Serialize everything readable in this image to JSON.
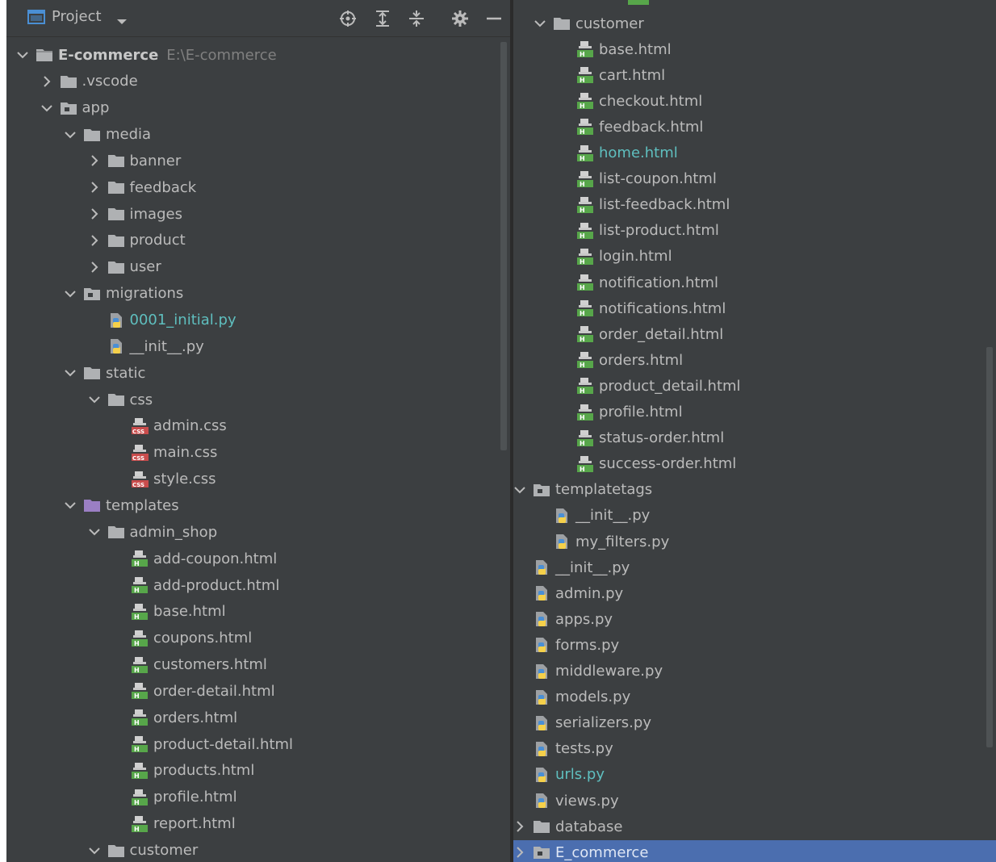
{
  "toolbar": {
    "title": "Project",
    "icons": [
      "project-window-icon",
      "dropdown-arrow-icon",
      "locate-icon",
      "expand-all-icon",
      "collapse-all-icon",
      "gear-icon",
      "hide-icon"
    ]
  },
  "colors": {
    "panel_bg": "#3c3f41",
    "text": "#bbbbbb",
    "modified_text": "#5fbfbf",
    "selection": "#4b6eaf",
    "folder": "#afb1b3",
    "templates_folder": "#9b7fc4",
    "python_blue": "#4a8fd4",
    "python_yellow": "#f5d04a",
    "html_green": "#57a64a",
    "css_red": "#c94c4c"
  },
  "left_tree": [
    {
      "depth": 0,
      "arrow": "down",
      "icon": "module-folder-icon",
      "label": "E-commerce",
      "path": "E:\\E-commerce",
      "style": "bold"
    },
    {
      "depth": 1,
      "arrow": "right",
      "icon": "folder-icon",
      "label": ".vscode"
    },
    {
      "depth": 1,
      "arrow": "down",
      "icon": "package-folder-icon",
      "label": "app"
    },
    {
      "depth": 2,
      "arrow": "down",
      "icon": "folder-icon",
      "label": "media"
    },
    {
      "depth": 3,
      "arrow": "right",
      "icon": "folder-icon",
      "label": "banner"
    },
    {
      "depth": 3,
      "arrow": "right",
      "icon": "folder-icon",
      "label": "feedback"
    },
    {
      "depth": 3,
      "arrow": "right",
      "icon": "folder-icon",
      "label": "images"
    },
    {
      "depth": 3,
      "arrow": "right",
      "icon": "folder-icon",
      "label": "product"
    },
    {
      "depth": 3,
      "arrow": "right",
      "icon": "folder-icon",
      "label": "user"
    },
    {
      "depth": 2,
      "arrow": "down",
      "icon": "package-folder-icon",
      "label": "migrations"
    },
    {
      "depth": 3,
      "arrow": "none",
      "icon": "python-file-icon",
      "label": "0001_initial.py",
      "style": "modified"
    },
    {
      "depth": 3,
      "arrow": "none",
      "icon": "python-file-icon",
      "label": "__init__.py"
    },
    {
      "depth": 2,
      "arrow": "down",
      "icon": "folder-icon",
      "label": "static"
    },
    {
      "depth": 3,
      "arrow": "down",
      "icon": "folder-icon",
      "label": "css"
    },
    {
      "depth": 4,
      "arrow": "none",
      "icon": "css-file-icon",
      "label": "admin.css"
    },
    {
      "depth": 4,
      "arrow": "none",
      "icon": "css-file-icon",
      "label": "main.css"
    },
    {
      "depth": 4,
      "arrow": "none",
      "icon": "css-file-icon",
      "label": "style.css"
    },
    {
      "depth": 2,
      "arrow": "down",
      "icon": "templates-folder-icon",
      "label": "templates"
    },
    {
      "depth": 3,
      "arrow": "down",
      "icon": "folder-icon",
      "label": "admin_shop"
    },
    {
      "depth": 4,
      "arrow": "none",
      "icon": "html-file-icon",
      "label": "add-coupon.html"
    },
    {
      "depth": 4,
      "arrow": "none",
      "icon": "html-file-icon",
      "label": "add-product.html"
    },
    {
      "depth": 4,
      "arrow": "none",
      "icon": "html-file-icon",
      "label": "base.html"
    },
    {
      "depth": 4,
      "arrow": "none",
      "icon": "html-file-icon",
      "label": "coupons.html"
    },
    {
      "depth": 4,
      "arrow": "none",
      "icon": "html-file-icon",
      "label": "customers.html"
    },
    {
      "depth": 4,
      "arrow": "none",
      "icon": "html-file-icon",
      "label": "order-detail.html"
    },
    {
      "depth": 4,
      "arrow": "none",
      "icon": "html-file-icon",
      "label": "orders.html"
    },
    {
      "depth": 4,
      "arrow": "none",
      "icon": "html-file-icon",
      "label": "product-detail.html"
    },
    {
      "depth": 4,
      "arrow": "none",
      "icon": "html-file-icon",
      "label": "products.html"
    },
    {
      "depth": 4,
      "arrow": "none",
      "icon": "html-file-icon",
      "label": "profile.html"
    },
    {
      "depth": 4,
      "arrow": "none",
      "icon": "html-file-icon",
      "label": "report.html"
    },
    {
      "depth": 3,
      "arrow": "down",
      "icon": "folder-icon",
      "label": "customer"
    }
  ],
  "right_tree": [
    {
      "depth": 3,
      "arrow": "down",
      "icon": "folder-icon",
      "label": "customer"
    },
    {
      "depth": 4,
      "arrow": "none",
      "icon": "html-file-icon",
      "label": "base.html"
    },
    {
      "depth": 4,
      "arrow": "none",
      "icon": "html-file-icon",
      "label": "cart.html"
    },
    {
      "depth": 4,
      "arrow": "none",
      "icon": "html-file-icon",
      "label": "checkout.html"
    },
    {
      "depth": 4,
      "arrow": "none",
      "icon": "html-file-icon",
      "label": "feedback.html"
    },
    {
      "depth": 4,
      "arrow": "none",
      "icon": "html-file-icon",
      "label": "home.html",
      "style": "modified"
    },
    {
      "depth": 4,
      "arrow": "none",
      "icon": "html-file-icon",
      "label": "list-coupon.html"
    },
    {
      "depth": 4,
      "arrow": "none",
      "icon": "html-file-icon",
      "label": "list-feedback.html"
    },
    {
      "depth": 4,
      "arrow": "none",
      "icon": "html-file-icon",
      "label": "list-product.html"
    },
    {
      "depth": 4,
      "arrow": "none",
      "icon": "html-file-icon",
      "label": "login.html"
    },
    {
      "depth": 4,
      "arrow": "none",
      "icon": "html-file-icon",
      "label": "notification.html"
    },
    {
      "depth": 4,
      "arrow": "none",
      "icon": "html-file-icon",
      "label": "notifications.html"
    },
    {
      "depth": 4,
      "arrow": "none",
      "icon": "html-file-icon",
      "label": "order_detail.html"
    },
    {
      "depth": 4,
      "arrow": "none",
      "icon": "html-file-icon",
      "label": "orders.html"
    },
    {
      "depth": 4,
      "arrow": "none",
      "icon": "html-file-icon",
      "label": "product_detail.html"
    },
    {
      "depth": 4,
      "arrow": "none",
      "icon": "html-file-icon",
      "label": "profile.html"
    },
    {
      "depth": 4,
      "arrow": "none",
      "icon": "html-file-icon",
      "label": "status-order.html"
    },
    {
      "depth": 4,
      "arrow": "none",
      "icon": "html-file-icon",
      "label": "success-order.html"
    },
    {
      "depth": 2,
      "arrow": "down",
      "icon": "package-folder-icon",
      "label": "templatetags"
    },
    {
      "depth": 3,
      "arrow": "none",
      "icon": "python-file-icon",
      "label": "__init__.py"
    },
    {
      "depth": 3,
      "arrow": "none",
      "icon": "python-file-icon",
      "label": "my_filters.py"
    },
    {
      "depth": 2,
      "arrow": "none",
      "icon": "python-file-icon",
      "label": "__init__.py"
    },
    {
      "depth": 2,
      "arrow": "none",
      "icon": "python-file-icon",
      "label": "admin.py"
    },
    {
      "depth": 2,
      "arrow": "none",
      "icon": "python-file-icon",
      "label": "apps.py"
    },
    {
      "depth": 2,
      "arrow": "none",
      "icon": "python-file-icon",
      "label": "forms.py"
    },
    {
      "depth": 2,
      "arrow": "none",
      "icon": "python-file-icon",
      "label": "middleware.py"
    },
    {
      "depth": 2,
      "arrow": "none",
      "icon": "python-file-icon",
      "label": "models.py"
    },
    {
      "depth": 2,
      "arrow": "none",
      "icon": "python-file-icon",
      "label": "serializers.py"
    },
    {
      "depth": 2,
      "arrow": "none",
      "icon": "python-file-icon",
      "label": "tests.py"
    },
    {
      "depth": 2,
      "arrow": "none",
      "icon": "python-file-icon",
      "label": "urls.py",
      "style": "modified"
    },
    {
      "depth": 2,
      "arrow": "none",
      "icon": "python-file-icon",
      "label": "views.py"
    },
    {
      "depth": 1,
      "arrow": "right",
      "icon": "folder-icon",
      "label": "database"
    },
    {
      "depth": 1,
      "arrow": "right",
      "icon": "package-folder-icon",
      "label": "E_commerce",
      "selected": true
    }
  ]
}
